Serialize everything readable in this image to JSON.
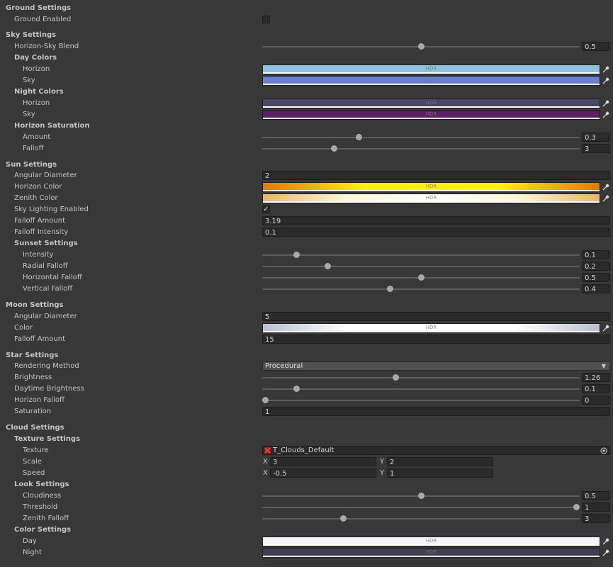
{
  "colors": {
    "sky_day_horizon": "#8ec3de",
    "sky_day_sky": "#6a7ed6",
    "sky_night_horizon": "#4b4566",
    "sky_night_sky": "#5e1f63",
    "sun_horizon": "linear-gradient(90deg,#e07a10 0%,#fff000 30%,#fff200 70%,#e07a10 100%)",
    "sun_zenith": "linear-gradient(90deg,#e4b770 0%,#fff6d8 25%,#ffffff 50%,#fff6d8 75%,#e4b770 100%)",
    "moon_color": "linear-gradient(90deg,#b9c1cb 0%,#ffffff 25%,#ffffff 75%,#b9c1cb 100%)",
    "cloud_day": "#f4f4f8",
    "cloud_night": "#413d52"
  },
  "hdr_label": "HDR",
  "ground": {
    "header": "Ground Settings",
    "enabled_label": "Ground Enabled"
  },
  "sky": {
    "header": "Sky Settings",
    "blend_label": "Horizon-Sky Blend",
    "blend_value": "0.5",
    "blend_fraction": 0.5,
    "day_header": "Day Colors",
    "day_horizon_label": "Horizon",
    "day_sky_label": "Sky",
    "night_header": "Night Colors",
    "night_horizon_label": "Horizon",
    "night_sky_label": "Sky",
    "saturation_header": "Horizon Saturation",
    "amount_label": "Amount",
    "amount_value": "0.3",
    "amount_fraction": 0.3,
    "falloff_label": "Falloff",
    "falloff_value": "3",
    "falloff_fraction": 0.22
  },
  "sun": {
    "header": "Sun Settings",
    "angular_label": "Angular Diameter",
    "angular_value": "2",
    "horizon_color_label": "Horizon Color",
    "zenith_color_label": "Zenith Color",
    "lighting_label": "Sky Lighting Enabled",
    "lighting_checked": "✓",
    "falloff_amount_label": "Falloff Amount",
    "falloff_amount_value": "3.19",
    "falloff_intensity_label": "Falloff Intensity",
    "falloff_intensity_value": "0.1",
    "sunset_header": "Sunset Settings",
    "intensity_label": "Intensity",
    "intensity_value": "0.1",
    "intensity_fraction": 0.1,
    "radial_label": "Radial Falloff",
    "radial_value": "0.2",
    "radial_fraction": 0.2,
    "horizontal_label": "Horizontal Falloff",
    "horizontal_value": "0.5",
    "horizontal_fraction": 0.5,
    "vertical_label": "Vertical Falloff",
    "vertical_value": "0.4",
    "vertical_fraction": 0.4
  },
  "moon": {
    "header": "Moon Settings",
    "angular_label": "Angular Diameter",
    "angular_value": "5",
    "color_label": "Color",
    "falloff_label": "Falloff Amount",
    "falloff_value": "15"
  },
  "star": {
    "header": "Star Settings",
    "method_label": "Rendering Method",
    "method_value": "Procedural",
    "brightness_label": "Brightness",
    "brightness_value": "1.26",
    "brightness_fraction": 0.42,
    "daytime_label": "Daytime Brightness",
    "daytime_value": "0.1",
    "daytime_fraction": 0.1,
    "horizon_falloff_label": "Horizon Falloff",
    "horizon_falloff_value": "0",
    "horizon_falloff_fraction": 0,
    "saturation_label": "Saturation",
    "saturation_value": "1"
  },
  "cloud": {
    "header": "Cloud Settings",
    "texture_header": "Texture Settings",
    "texture_label": "Texture",
    "texture_value": "T_Clouds_Default",
    "scale_label": "Scale",
    "scale_x": "3",
    "scale_y": "2",
    "speed_label": "Speed",
    "speed_x": "-0.5",
    "speed_y": "1",
    "x_label": "X",
    "y_label": "Y",
    "look_header": "Look Settings",
    "cloudiness_label": "Cloudiness",
    "cloudiness_value": "0.5",
    "cloudiness_fraction": 0.5,
    "threshold_label": "Threshold",
    "threshold_value": "1",
    "threshold_fraction": 1,
    "zenith_label": "Zenith Falloff",
    "zenith_value": "3",
    "zenith_fraction": 0.25,
    "color_header": "Color Settings",
    "day_label": "Day",
    "night_label": "Night"
  }
}
